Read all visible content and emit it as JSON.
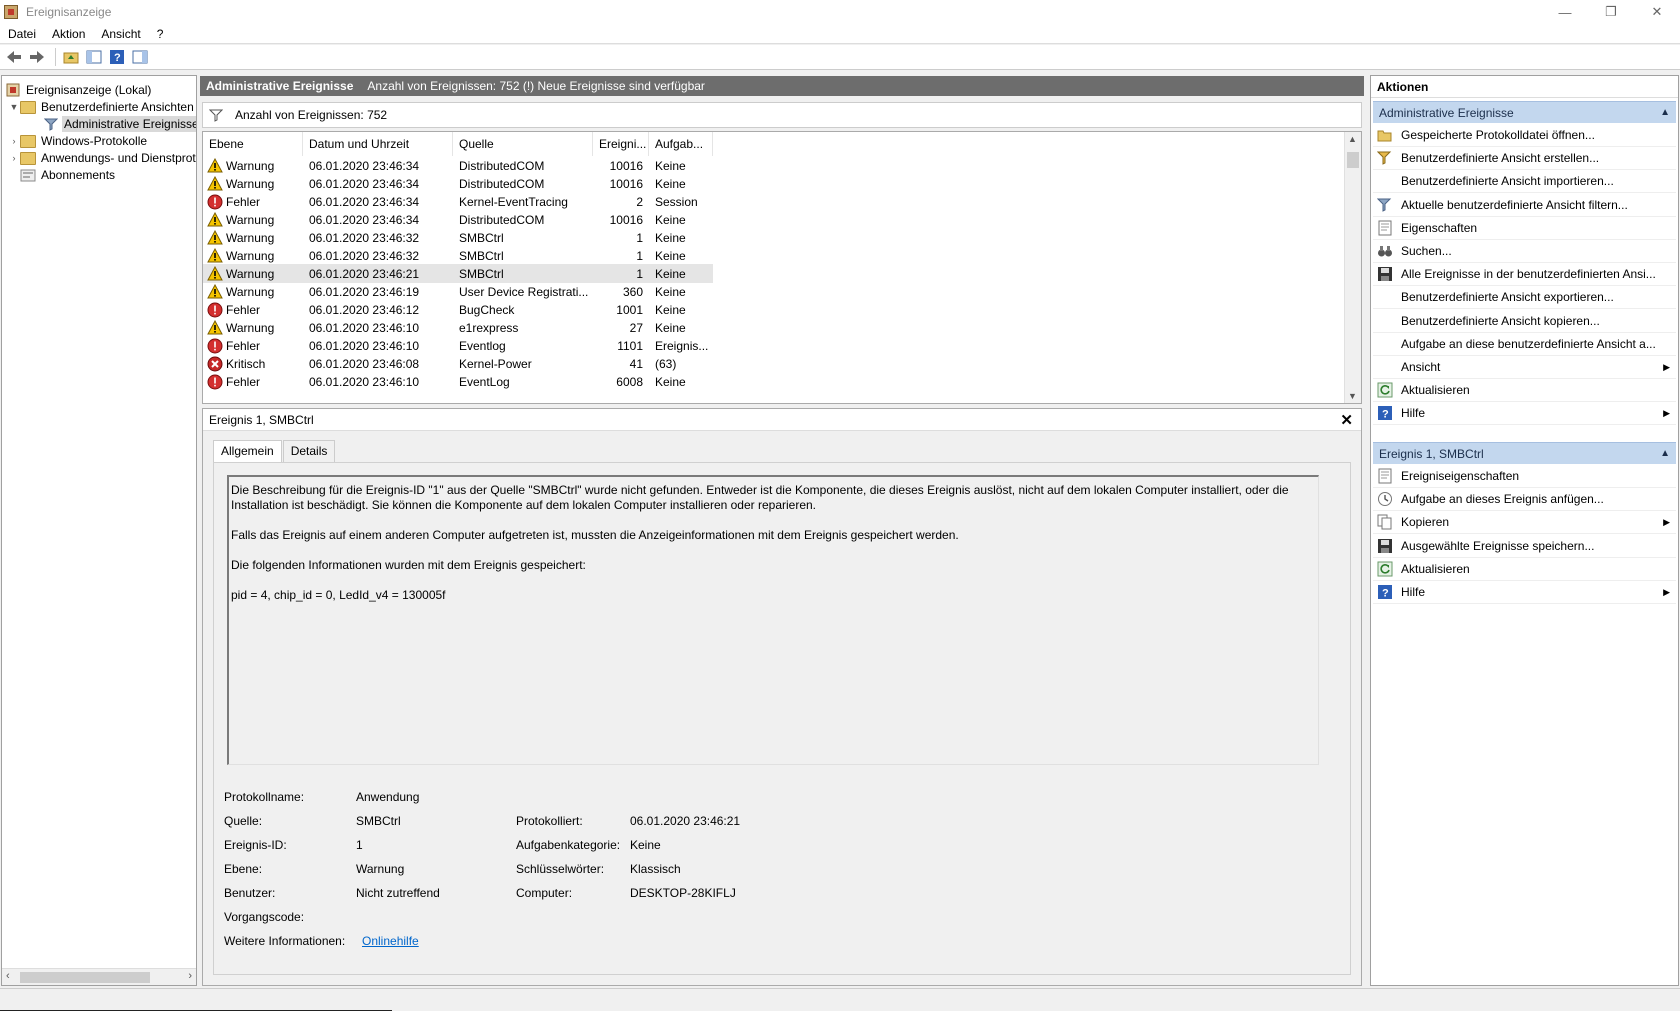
{
  "window": {
    "title": "Ereignisanzeige",
    "controls": [
      "—",
      "❐",
      "✕"
    ]
  },
  "menu": [
    "Datei",
    "Aktion",
    "Ansicht",
    "?"
  ],
  "tree": {
    "items": [
      {
        "label": "Ereignisanzeige (Lokal)",
        "level": 0,
        "icon": "event-viewer-icon"
      },
      {
        "label": "Benutzerdefinierte Ansichten",
        "level": 1,
        "icon": "folder-icon",
        "expanded": true
      },
      {
        "label": "Administrative Ereignisse",
        "level": 2,
        "icon": "filter-icon",
        "selected": true
      },
      {
        "label": "Windows-Protokolle",
        "level": 1,
        "icon": "folder-icon"
      },
      {
        "label": "Anwendungs- und Dienstprotokolle",
        "level": 1,
        "icon": "folder-icon"
      },
      {
        "label": "Abonnements",
        "level": 1,
        "icon": "subscription-icon"
      }
    ]
  },
  "header": {
    "title": "Administrative Ereignisse",
    "subtitle": "Anzahl von Ereignissen: 752 (!) Neue Ereignisse sind verfügbar"
  },
  "filter_bar": {
    "text": "Anzahl von Ereignissen: 752"
  },
  "list": {
    "columns": [
      "Ebene",
      "Datum und Uhrzeit",
      "Quelle",
      "Ereigni...",
      "Aufgab..."
    ],
    "rows": [
      {
        "level": "Warnung",
        "type": "warning",
        "datetime": "06.01.2020 23:46:34",
        "source": "DistributedCOM",
        "id": "10016",
        "task": "Keine"
      },
      {
        "level": "Warnung",
        "type": "warning",
        "datetime": "06.01.2020 23:46:34",
        "source": "DistributedCOM",
        "id": "10016",
        "task": "Keine"
      },
      {
        "level": "Fehler",
        "type": "error",
        "datetime": "06.01.2020 23:46:34",
        "source": "Kernel-EventTracing",
        "id": "2",
        "task": "Session"
      },
      {
        "level": "Warnung",
        "type": "warning",
        "datetime": "06.01.2020 23:46:34",
        "source": "DistributedCOM",
        "id": "10016",
        "task": "Keine"
      },
      {
        "level": "Warnung",
        "type": "warning",
        "datetime": "06.01.2020 23:46:32",
        "source": "SMBCtrl",
        "id": "1",
        "task": "Keine"
      },
      {
        "level": "Warnung",
        "type": "warning",
        "datetime": "06.01.2020 23:46:32",
        "source": "SMBCtrl",
        "id": "1",
        "task": "Keine"
      },
      {
        "level": "Warnung",
        "type": "warning",
        "datetime": "06.01.2020 23:46:21",
        "source": "SMBCtrl",
        "id": "1",
        "task": "Keine",
        "selected": true
      },
      {
        "level": "Warnung",
        "type": "warning",
        "datetime": "06.01.2020 23:46:19",
        "source": "User Device Registrati...",
        "id": "360",
        "task": "Keine"
      },
      {
        "level": "Fehler",
        "type": "error",
        "datetime": "06.01.2020 23:46:12",
        "source": "BugCheck",
        "id": "1001",
        "task": "Keine"
      },
      {
        "level": "Warnung",
        "type": "warning",
        "datetime": "06.01.2020 23:46:10",
        "source": "e1rexpress",
        "id": "27",
        "task": "Keine"
      },
      {
        "level": "Fehler",
        "type": "error",
        "datetime": "06.01.2020 23:46:10",
        "source": "Eventlog",
        "id": "1101",
        "task": "Ereignis..."
      },
      {
        "level": "Kritisch",
        "type": "critical",
        "datetime": "06.01.2020 23:46:08",
        "source": "Kernel-Power",
        "id": "41",
        "task": "(63)"
      },
      {
        "level": "Fehler",
        "type": "error",
        "datetime": "06.01.2020 23:46:10",
        "source": "EventLog",
        "id": "6008",
        "task": "Keine"
      }
    ]
  },
  "detail": {
    "title": "Ereignis 1, SMBCtrl",
    "close_glyph": "✕",
    "tabs": [
      "Allgemein",
      "Details"
    ],
    "description": [
      "Die Beschreibung für die Ereignis-ID \"1\" aus der Quelle \"SMBCtrl\" wurde nicht gefunden. Entweder ist die Komponente, die dieses Ereignis auslöst, nicht auf dem lokalen Computer installiert, oder die Installation ist beschädigt. Sie können die Komponente auf dem lokalen Computer installieren oder reparieren.",
      "Falls das Ereignis auf einem anderen Computer aufgetreten ist, mussten die Anzeigeinformationen mit dem Ereignis gespeichert werden.",
      "Die folgenden Informationen wurden mit dem Ereignis gespeichert:",
      "pid = 4, chip_id = 0, LedId_v4 = 130005f"
    ],
    "props": {
      "protokollname": {
        "label": "Protokollname:",
        "value": "Anwendung"
      },
      "quelle": {
        "label": "Quelle:",
        "value": "SMBCtrl"
      },
      "protokolliert": {
        "label": "Protokolliert:",
        "value": "06.01.2020 23:46:21"
      },
      "ereignis_id": {
        "label": "Ereignis-ID:",
        "value": "1"
      },
      "aufgabenkategorie": {
        "label": "Aufgabenkategorie:",
        "value": "Keine"
      },
      "ebene": {
        "label": "Ebene:",
        "value": "Warnung"
      },
      "schluesselwoerter": {
        "label": "Schlüsselwörter:",
        "value": "Klassisch"
      },
      "benutzer": {
        "label": "Benutzer:",
        "value": "Nicht zutreffend"
      },
      "computer": {
        "label": "Computer:",
        "value": "DESKTOP-28KIFLJ"
      },
      "vorgangscode": {
        "label": "Vorgangscode:",
        "value": ""
      },
      "weitere": {
        "label": "Weitere Informationen:",
        "value": "Onlinehilfe"
      }
    }
  },
  "actions": {
    "title": "Aktionen",
    "section1": {
      "title": "Administrative Ereignisse",
      "items": [
        {
          "label": "Gespeicherte Protokolldatei öffnen...",
          "icon": "open-folder-icon"
        },
        {
          "label": "Benutzerdefinierte Ansicht erstellen...",
          "icon": "filter-create-icon"
        },
        {
          "label": "Benutzerdefinierte Ansicht importieren...",
          "icon": ""
        },
        {
          "label": "Aktuelle benutzerdefinierte Ansicht filtern...",
          "icon": "filter-icon"
        },
        {
          "label": "Eigenschaften",
          "icon": "properties-icon"
        },
        {
          "label": "Suchen...",
          "icon": "binoculars-icon"
        },
        {
          "label": "Alle Ereignisse in der benutzerdefinierten Ansi...",
          "icon": "save-icon"
        },
        {
          "label": "Benutzerdefinierte Ansicht exportieren...",
          "icon": ""
        },
        {
          "label": "Benutzerdefinierte Ansicht kopieren...",
          "icon": ""
        },
        {
          "label": "Aufgabe an diese benutzerdefinierte Ansicht a...",
          "icon": ""
        },
        {
          "label": "Ansicht",
          "icon": "",
          "submenu": true
        },
        {
          "label": "Aktualisieren",
          "icon": "refresh-icon"
        },
        {
          "label": "Hilfe",
          "icon": "help-icon",
          "submenu": true
        }
      ]
    },
    "section2": {
      "title": "Ereignis 1, SMBCtrl",
      "items": [
        {
          "label": "Ereigniseigenschaften",
          "icon": "properties-icon"
        },
        {
          "label": "Aufgabe an dieses Ereignis anfügen...",
          "icon": "task-icon"
        },
        {
          "label": "Kopieren",
          "icon": "copy-icon",
          "submenu": true
        },
        {
          "label": "Ausgewählte Ereignisse speichern...",
          "icon": "save-icon"
        },
        {
          "label": "Aktualisieren",
          "icon": "refresh-icon"
        },
        {
          "label": "Hilfe",
          "icon": "help-icon",
          "submenu": true
        }
      ]
    }
  },
  "colors": {
    "header_bg": "#6d6d6d",
    "section_bg": "#c3d7ee",
    "warning": "#f5c400",
    "error": "#d32f2f",
    "link": "#0066cc"
  }
}
